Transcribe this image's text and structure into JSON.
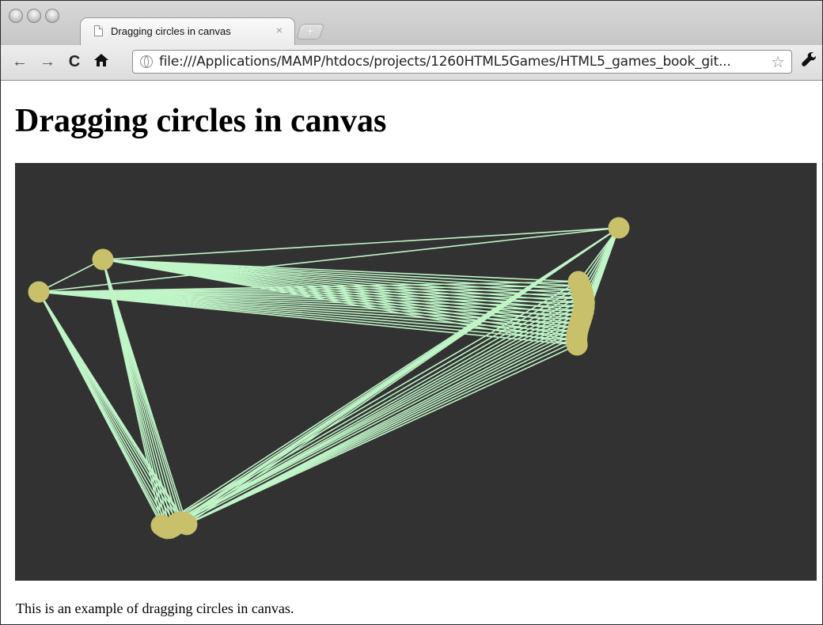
{
  "window": {
    "tab": {
      "title": "Dragging circles in canvas",
      "close_icon": "×",
      "new_tab_icon": "+"
    },
    "toolbar": {
      "back_icon": "←",
      "forward_icon": "→",
      "reload_icon": "C",
      "home_icon": "🏠",
      "url": "file:///Applications/MAMP/htdocs/projects/1260HTML5Games/HTML5_games_book_git...",
      "bookmark_icon": "☆",
      "wrench_icon": "🔧"
    }
  },
  "page": {
    "heading": "Dragging circles in canvas",
    "caption": "This is an example of dragging circles in canvas."
  },
  "canvas": {
    "background": "#323232",
    "line_color": "#c0f5c8",
    "circle_color": "#c8c06a"
  }
}
